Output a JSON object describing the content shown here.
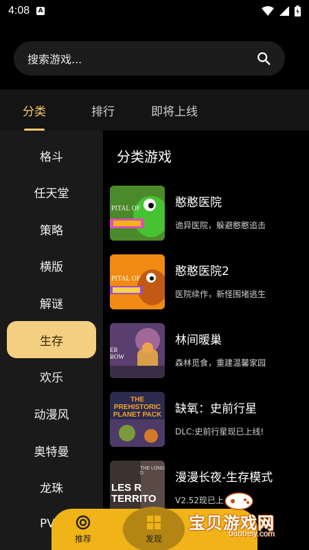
{
  "status": {
    "time": "4:08",
    "app_badge": "A"
  },
  "search": {
    "placeholder": "搜索游戏..."
  },
  "tabs": [
    {
      "label": "分类"
    },
    {
      "label": "排行"
    },
    {
      "label": "即将上线"
    }
  ],
  "sidebar": {
    "items": [
      {
        "label": "格斗"
      },
      {
        "label": "任天堂"
      },
      {
        "label": "策略"
      },
      {
        "label": "横版"
      },
      {
        "label": "解谜"
      },
      {
        "label": "生存"
      },
      {
        "label": "欢乐"
      },
      {
        "label": "动漫风"
      },
      {
        "label": "奥特曼"
      },
      {
        "label": "龙珠"
      },
      {
        "label": "PV"
      }
    ],
    "selected": "生存"
  },
  "content": {
    "title": "分类游戏",
    "games": [
      {
        "name": "憨憨医院",
        "desc": "诡异医院，躲避憨憨追击",
        "thumb_text": "PITAL OF"
      },
      {
        "name": "憨憨医院2",
        "desc": "医院续作，新怪围堵逃生",
        "thumb_text": "PITAL OF"
      },
      {
        "name": "林间暖巢",
        "desc": "森林觅食，重建温馨家园",
        "thumb_text": "ER ROW"
      },
      {
        "name": "缺氧：史前行星",
        "desc": "DLC:史前行星现已上线!",
        "thumb_text": "THE PREHISTORIC PLANET PACK"
      },
      {
        "name": "漫漫长夜-生存模式",
        "desc": "V2.52现已上",
        "thumb_text": "LES R TERRITO",
        "thumb_sub": "THE LONG D"
      }
    ]
  },
  "bottom_nav": {
    "items": [
      {
        "label": "推荐"
      },
      {
        "label": "发现"
      }
    ]
  },
  "watermark": {
    "text": "宝贝游戏网",
    "url": "baobeiy.com"
  }
}
